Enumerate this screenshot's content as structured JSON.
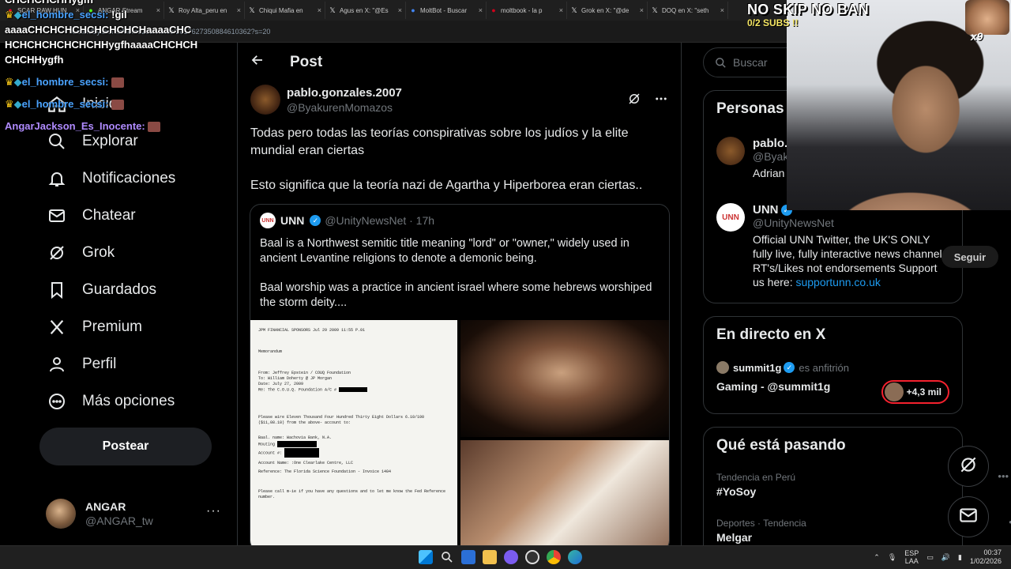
{
  "browser": {
    "tabs": [
      {
        "label": "SCAR RAW HUN",
        "icon": "youtube-icon",
        "color": "#ff0033"
      },
      {
        "label": "ANGAR Stream",
        "icon": "kick-icon",
        "color": "#53fc18"
      },
      {
        "label": "Roy Alta_peru en",
        "icon": "x-icon",
        "color": "#e7e9ea"
      },
      {
        "label": "Chiqui Mafia en",
        "icon": "x-icon",
        "color": "#e7e9ea"
      },
      {
        "label": "Agus en X: \"@Es",
        "icon": "x-icon",
        "color": "#e7e9ea"
      },
      {
        "label": "MoltBot - Buscar",
        "icon": "google-icon",
        "color": "#4285f4"
      },
      {
        "label": "moltbook - la p",
        "icon": "pin-icon",
        "color": "#d0021b"
      },
      {
        "label": "Grok en X: \"@de",
        "icon": "x-icon",
        "color": "#e7e9ea"
      },
      {
        "label": "DOQ en X: \"seth",
        "icon": "x-icon",
        "color": "#e7e9ea"
      }
    ],
    "url": "x.com/ByakurenMomazos/status/2017627350884610362?s=20"
  },
  "nav": {
    "items": [
      {
        "label": "Inicio",
        "icon": "home-icon"
      },
      {
        "label": "Explorar",
        "icon": "search-icon"
      },
      {
        "label": "Notificaciones",
        "icon": "bell-icon"
      },
      {
        "label": "Chatear",
        "icon": "mail-icon"
      },
      {
        "label": "Grok",
        "icon": "grok-icon"
      },
      {
        "label": "Guardados",
        "icon": "bookmark-icon"
      },
      {
        "label": "Premium",
        "icon": "x-logo-icon"
      },
      {
        "label": "Perfil",
        "icon": "person-icon"
      },
      {
        "label": "Más opciones",
        "icon": "more-circle-icon"
      }
    ],
    "post_button": "Postear",
    "user": {
      "name": "ANGAR",
      "handle": "@ANGAR_tw",
      "more": "···"
    }
  },
  "post": {
    "header_title": "Post",
    "author_name": "pablo.gonzales.2007",
    "author_handle": "@ByakurenMomazos",
    "text_p1": "Todas pero todas las teorías conspirativas sobre los judíos y la elite mundial eran ciertas",
    "text_p2": "Esto significa que la teoría nazi de Agartha y Hiperborea eran ciertas..",
    "quote": {
      "avatar_text": "UNN",
      "name": "UNN",
      "handle_time": "@UnityNewsNet · 17h",
      "p1": "Baal is a Northwest semitic title meaning \"lord\" or \"owner,\" widely used in ancient Levantine religions to denote a demonic being.",
      "p2": "Baal worship was a practice in ancient israel where some hebrews worshiped the storm deity....",
      "memo": {
        "header": "JPM FINANCIAL SPONSORS  Jul 29 2009 11:55 P.01",
        "title": "Memorandum",
        "from": "From: Jeffrey Epstein / COUQ Foundation",
        "to": "To: William Doherty @ JP Morgan",
        "date": "Date: July 27, 2009",
        "re": "Re: The C.O.U.Q. Foundation A/C #",
        "wire": "Please wire Eleven Thousand Four Hundred Thirty Eight Dollars 6.10/100 ($11,08.10) from the above- account to:",
        "bank": "Baal. name: Wachovia Bank, N.A.",
        "routing": "Routing",
        "account": "Account #:",
        "account_name": "Account Name: :One Clearlake Centre, LLC",
        "reference": "Reference: The Florida Science Foundation - Invoice 1404",
        "closing": "Please call m-ie if you have any questions and to let me know the Fed Reference number."
      }
    }
  },
  "right": {
    "search_placeholder": "Buscar",
    "people": {
      "title": "Personas",
      "p1": {
        "name": "pablo.gonzales.2007",
        "handle": "@ByakurenMomazos",
        "bio": "Adrian"
      },
      "p2": {
        "name": "UNN",
        "handle": "@UnityNewsNet",
        "follow": "Seguir",
        "bio": "Official UNN Twitter, the UK'S ONLY fully live, fully interactive news channel. RT's/Likes not endorsements Support us here: ",
        "link": "supportunn.co.uk"
      }
    },
    "live": {
      "title": "En directo en X",
      "host": "summit1g",
      "host_role": "es anfitrión",
      "space_title": "Gaming - @summit1g",
      "listeners": "+4,3 mil"
    },
    "trends": {
      "title": "Qué está pasando",
      "items": [
        {
          "meta": "Tendencia en Perú",
          "name": "#YoSoy"
        },
        {
          "meta": "Deportes · Tendencia",
          "name": "Melgar"
        }
      ]
    }
  },
  "overlay": {
    "chat": {
      "top_fragment": "CHCHCHCHHygfh",
      "m1_user": "el_hombre_secsi:",
      "m1_text": "!gil",
      "m1_body": "aaaaCHCHCHCHCHCHCHCHaaaaCHCHCHCHCHCHCHCHHygfhaaaaCHCHCHCHCHHygfh",
      "m2_user": "el_hombre_secsi:",
      "m3_user": "el_hombre_secsi:",
      "m4_user": "AngarJackson_Es_Inocente:"
    },
    "banner": "NO SKIP NO BAN",
    "subs": "0/2 SUBS !!",
    "multiplier": "x9"
  },
  "taskbar": {
    "lang_top": "ESP",
    "lang_bottom": "LAA",
    "time": "00:37",
    "date": "1/02/2026"
  }
}
